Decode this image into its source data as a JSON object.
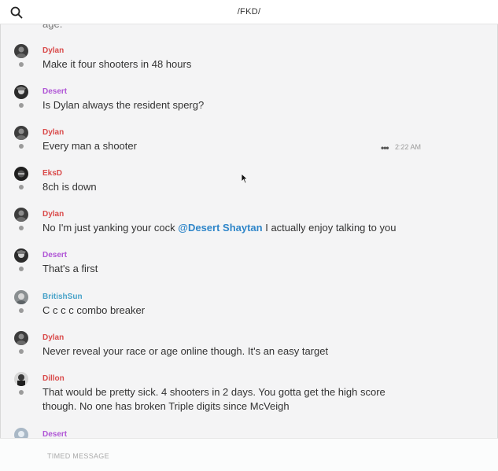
{
  "header": {
    "channel": "/FKD/"
  },
  "composer": {
    "placeholder": "TIMED MESSAGE"
  },
  "partial_top_text": "age.",
  "messages": [
    {
      "author": "Dylan",
      "color": "#d94a4a",
      "text": "Make it four shooters in 48 hours"
    },
    {
      "author": "Desert",
      "color": "#b056d6",
      "text": "Is Dylan always the resident sperg?"
    },
    {
      "author": "Dylan",
      "color": "#d94a4a",
      "text": "Every man a shooter",
      "time": "2:22 AM"
    },
    {
      "author": "EksD",
      "color": "#d94a4a",
      "text": "8ch is down"
    },
    {
      "author": "Dylan",
      "color": "#d94a4a",
      "text_before": "No I'm just yanking your cock ",
      "mention": "@Desert Shaytan",
      "text_after": " I actually enjoy talking to you"
    },
    {
      "author": "Desert",
      "color": "#b056d6",
      "text": "That's a first"
    },
    {
      "author": "BritishSun",
      "color": "#4aa3c9",
      "text": "C c c c combo breaker"
    },
    {
      "author": "Dylan",
      "color": "#d94a4a",
      "text": "Never reveal your race or age online though. It's an easy target"
    },
    {
      "author": "Dillon",
      "color": "#d94a4a",
      "text_line1": "That would be pretty sick. 4 shooters in 2 days. You gotta get the high score",
      "text_line2": "though. No one has broken Triple digits since McVeigh"
    },
    {
      "author": "Desert",
      "color": "#b056d6"
    }
  ]
}
